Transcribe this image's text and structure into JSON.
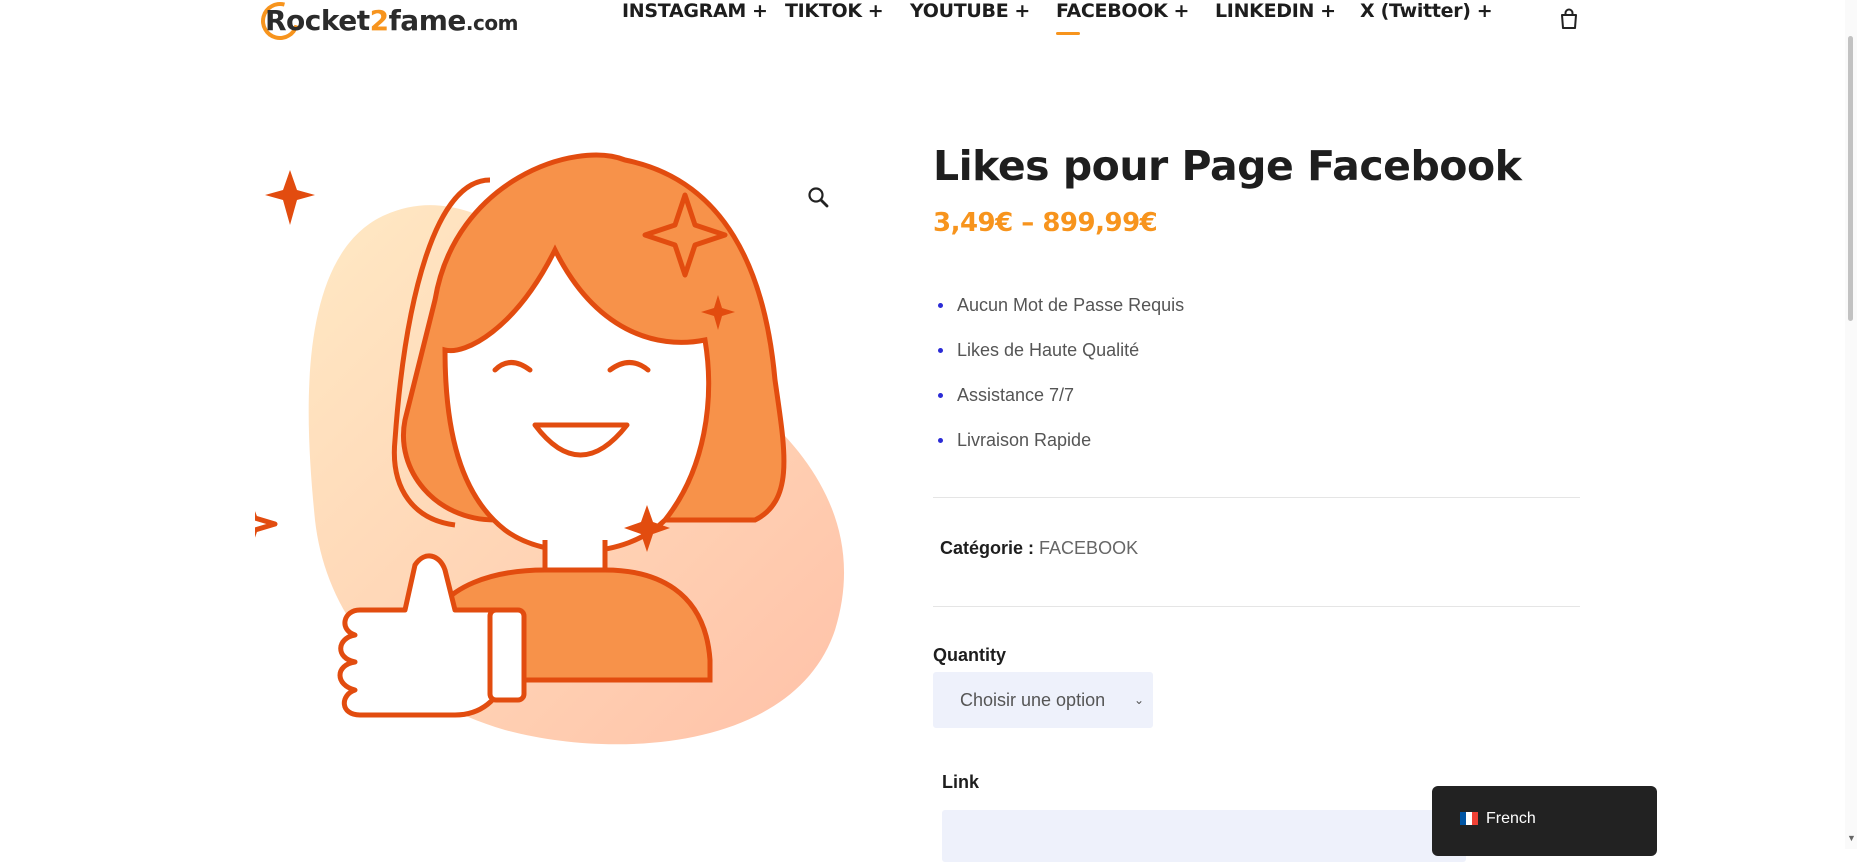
{
  "header": {
    "logo": {
      "part1": "Rocket",
      "part2": "2",
      "part3": "fame",
      "domain": ".com"
    },
    "nav": [
      {
        "label": "INSTAGRAM",
        "plus": "+"
      },
      {
        "label": "TIKTOK",
        "plus": "+"
      },
      {
        "label": "YOUTUBE",
        "plus": "+"
      },
      {
        "label": "FACEBOOK",
        "plus": "+",
        "active": true
      },
      {
        "label": "LINKEDIN",
        "plus": "+"
      },
      {
        "label": "X (Twitter)",
        "plus": "+"
      }
    ],
    "cart_icon": "shopping-bag-icon"
  },
  "product": {
    "title": "Likes pour Page Facebook",
    "price": "3,49€ – 899,99€",
    "features": [
      "Aucun Mot de Passe Requis",
      "Likes de Haute Qualité",
      "Assistance 7/7",
      "Livraison Rapide"
    ],
    "category_label": "Catégorie :",
    "category_value": "FACEBOOK",
    "quantity_label": "Quantity",
    "quantity_selected": "Choisir une option",
    "link_label": "Link",
    "link_value": ""
  },
  "image": {
    "zoom_icon": "magnifier-icon"
  },
  "language_switcher": {
    "label": "French",
    "flag": "france-flag-icon"
  },
  "colors": {
    "accent": "#f7941d",
    "illustration": "#e8501a",
    "bullet": "#2b2bd6",
    "input_bg": "#eef1fb"
  }
}
